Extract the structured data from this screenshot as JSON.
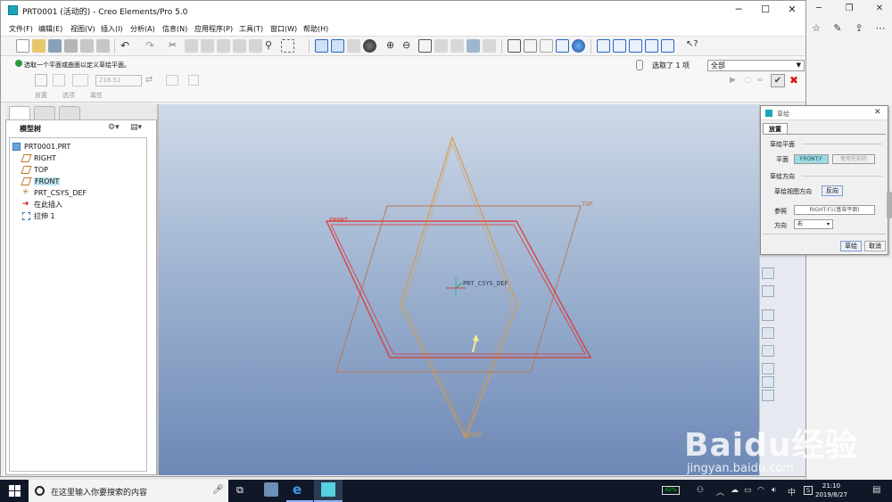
{
  "window": {
    "title": "PRT0001 (活动的) - Creo Elements/Pro 5.0",
    "min_icon": "minimize-icon",
    "max_icon": "maximize-icon",
    "close_icon": "close-icon"
  },
  "menubar": [
    "文件(F)",
    "编辑(E)",
    "视图(V)",
    "插入(I)",
    "分析(A)",
    "信息(N)",
    "应用程序(P)",
    "工具(T)",
    "窗口(W)",
    "帮助(H)"
  ],
  "dashboard": {
    "prompt": "选取一个平面或曲面以定义草绘平面。",
    "selection_label": "选取了 1 项",
    "filter_value": "全部",
    "depth_value": "216.51",
    "tabs": [
      "放置",
      "选项",
      "属性"
    ]
  },
  "model_tree": {
    "header": "模型树",
    "items": [
      {
        "label": "PRT0001.PRT",
        "icon": "part-icon"
      },
      {
        "label": "RIGHT",
        "icon": "datum-plane-icon"
      },
      {
        "label": "TOP",
        "icon": "datum-plane-icon"
      },
      {
        "label": "FRONT",
        "icon": "datum-plane-icon"
      },
      {
        "label": "PRT_CSYS_DEF",
        "icon": "csys-icon"
      },
      {
        "label": "在此插入",
        "icon": "insert-here-icon"
      },
      {
        "label": "拉伸 1",
        "icon": "extrude-icon"
      }
    ]
  },
  "graphics": {
    "labels": {
      "front": "FRONT",
      "top": "TOP",
      "right": "RIGHT",
      "csys": "PRT_CSYS_DEF"
    }
  },
  "sketch_dialog": {
    "title": "草绘",
    "tab": "放置",
    "sketch_plane_header": "草绘平面",
    "plane_label": "平面",
    "plane_value": "FRONT:F",
    "use_previous_label": "使用先前的",
    "sketch_orientation_header": "草绘方向",
    "view_direction_label": "草绘视图方向",
    "flip_button": "反向",
    "reference_label": "参照",
    "reference_value": "RIGHT:F1(基准平面)",
    "orientation_label": "方向",
    "orientation_value": "右",
    "sketch_button": "草绘",
    "cancel_button": "取消"
  },
  "taskbar": {
    "search_placeholder": "在这里输入你要搜索的内容",
    "battery": "42%",
    "time": "21:10",
    "date": "2019/8/27",
    "tray_lang": "中"
  },
  "watermark": {
    "brand": "Baidu经验",
    "url": "jingyan.baidu.com"
  },
  "colors": {
    "accent_teal": "#1aa6b7",
    "datum_orange": "#d99a4a",
    "selected_red": "#e4342e"
  }
}
